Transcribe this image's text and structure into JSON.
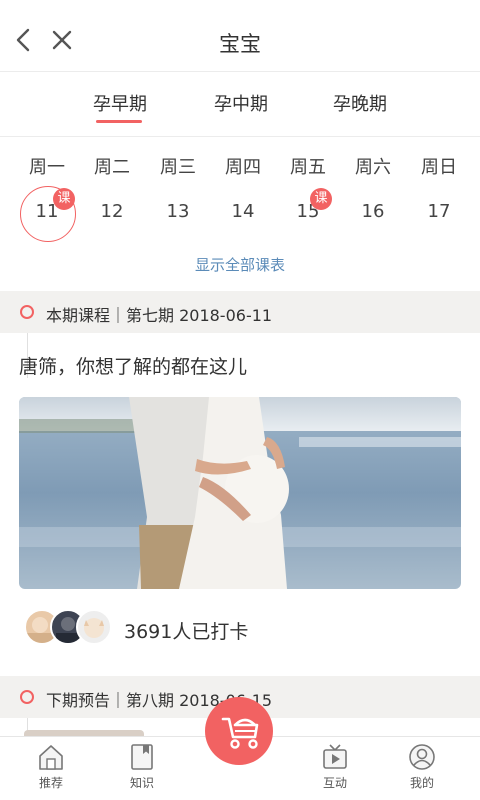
{
  "header": {
    "title": "宝宝"
  },
  "period_tabs": [
    {
      "label": "孕早期",
      "active": true
    },
    {
      "label": "孕中期",
      "active": false
    },
    {
      "label": "孕晚期",
      "active": false
    }
  ],
  "week": {
    "days": [
      "周一",
      "周二",
      "周三",
      "周四",
      "周五",
      "周六",
      "周日"
    ],
    "dates": [
      "11",
      "12",
      "13",
      "14",
      "15",
      "16",
      "17"
    ],
    "selected_index": 0,
    "badge_text": "课",
    "badge_indexes": [
      0,
      4
    ],
    "show_all": "显示全部课表"
  },
  "current_course": {
    "label": "本期课程｜第七期  2018-06-11",
    "headline": "唐筛，你想了解的都在这儿",
    "checkin_text": "3691人已打卡"
  },
  "next_course": {
    "label": "下期预告｜第八期  2018-06-15"
  },
  "tabbar": {
    "items": [
      {
        "label": "推荐",
        "icon": "home-icon"
      },
      {
        "label": "知识",
        "icon": "book-icon"
      },
      {
        "label": "",
        "icon": "stroller-icon"
      },
      {
        "label": "互动",
        "icon": "tv-icon"
      },
      {
        "label": "我的",
        "icon": "user-icon"
      }
    ]
  },
  "colors": {
    "accent": "#f26262",
    "link": "#5b8bb8",
    "section_bg": "#f2f1ef"
  }
}
